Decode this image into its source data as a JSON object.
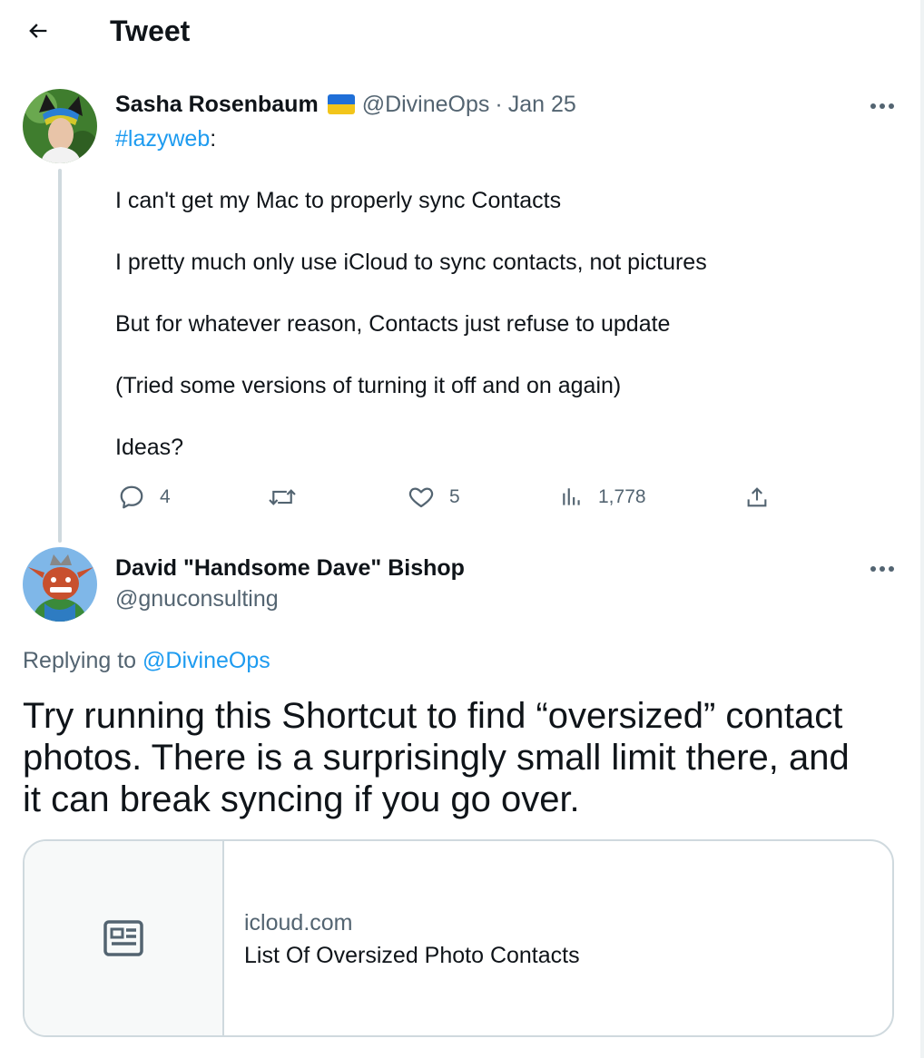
{
  "header": {
    "title": "Tweet"
  },
  "original_tweet": {
    "author_name": "Sasha Rosenbaum",
    "flag": "Ukraine flag",
    "handle": "@DivineOps",
    "separator": "·",
    "date": "Jan 25",
    "hashtag": "#lazyweb",
    "hashtag_suffix": ":",
    "lines": [
      "I can't get my Mac to properly sync Contacts",
      "I pretty much only use iCloud to sync contacts, not pictures",
      "But for whatever reason, Contacts just refuse to update",
      "(Tried some versions of turning it off and on again)",
      "Ideas?"
    ],
    "actions": {
      "replies": "4",
      "retweets": "",
      "likes": "5",
      "views": "1,778"
    }
  },
  "reply_tweet": {
    "author_name": "David \"Handsome Dave\" Bishop",
    "handle": "@gnuconsulting",
    "replying_prefix": "Replying to",
    "replying_handle": "@DivineOps",
    "text_lines": [
      "Try running this Shortcut to find “oversized” contact",
      "photos. There is a surprisingly small limit there, and",
      "it can break syncing if you go over."
    ],
    "card": {
      "domain": "icloud.com",
      "title": "List Of Oversized Photo Contacts"
    }
  },
  "icons": {
    "back": "arrow-left-icon",
    "more": "more-horizontal-icon",
    "reply": "speech-bubble-icon",
    "retweet": "retweet-icon",
    "like": "heart-icon",
    "views": "bar-chart-icon",
    "share": "share-upload-icon",
    "card": "news-article-icon"
  },
  "colors": {
    "link": "#1d9bf0",
    "text": "#0f1419",
    "muted": "#536471",
    "border": "#cfd9de"
  }
}
